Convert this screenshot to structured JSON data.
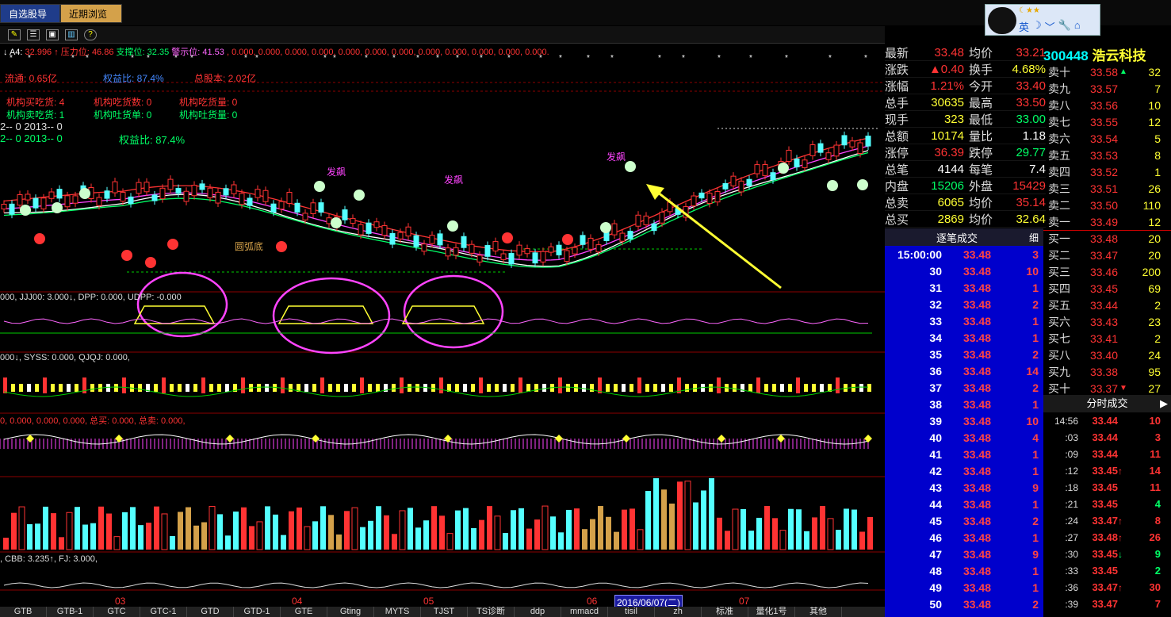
{
  "toolbar": {
    "tabs": [
      "自选股导入",
      "近期浏览"
    ],
    "icons": [
      "wand-icon",
      "list-icon",
      "info-icon",
      "chart-icon",
      "help-icon"
    ]
  },
  "qq": {
    "labels": [
      "英",
      "☽",
      "﹀",
      "🔧",
      "⌂"
    ]
  },
  "indicator_line": {
    "prefix": "↓ A4:",
    "a4": "32.996",
    "pressure_label": "↑ 压力位:",
    "pressure": "46.86",
    "support_label": "支撑位:",
    "support": "32.35",
    "warn_label": "警示位:",
    "warn": "41.53",
    "rest": ", 0.000, 0.000, 0.000, 0.000, 0.000, 0.000, 0.000, 0.000, 0.000, 0.000, 0.000, 0.000."
  },
  "info_lines": {
    "liutong": "流通: 0.65亿",
    "quanyi": "权益比: 87.4%",
    "zongguben": "总股本: 2.02亿",
    "jg1": "机构买吃货: 4",
    "jg2": "机构吃货数: 0",
    "jg3": "机构吃货量: 0",
    "jg4": "机构卖吃货: 1",
    "jg5": "机构吐货单: 0",
    "jg6": "机构吐货量: 0",
    "y1": "2-- 0    2013-- 0",
    "y2": "2-- 0    2013-- 0",
    "quanyi2": "权益比: 87.4%"
  },
  "annotations": {
    "fabiao": "发飙",
    "yuanhudi": "圆弧底"
  },
  "panel1_label": "000, JJJ00: 3.000↓, DPP: 0.000, UDPP: -0.000",
  "panel2_label": "000↓, SYSS: 0.000, QJQJ: 0.000,",
  "panel3_label": "0, 0.000, 0.000, 0.000, 总买: 0.000, 总卖: 0.000,",
  "panel5_label": ", CBB: 3.235↑, FJ: 3.000,",
  "date_axis": {
    "labels": [
      "03",
      "04",
      "05",
      "06",
      "07"
    ],
    "cursor": "2016/06/07(二)"
  },
  "bottom_tabs": [
    "GTB",
    "GTB-1",
    "GTC",
    "GTC-1",
    "GTD",
    "GTD-1",
    "GTE",
    "Gting",
    "MYTS",
    "TJST",
    "TS诊断",
    "ddp",
    "mmacd",
    "tisil",
    "zh",
    "标准",
    "量化1号",
    "其他"
  ],
  "stock": {
    "code": "300448",
    "name": "浩云科技"
  },
  "quote": [
    {
      "l1": "最新",
      "v1": "33.48",
      "c1": "#ff3333",
      "l2": "均价",
      "v2": "33.21",
      "c2": "#ff3333"
    },
    {
      "l1": "涨跌",
      "v1": "▲0.40",
      "c1": "#ff3333",
      "l2": "换手",
      "v2": "4.68%",
      "c2": "#ffff33"
    },
    {
      "l1": "涨幅",
      "v1": "1.21%",
      "c1": "#ff3333",
      "l2": "今开",
      "v2": "33.40",
      "c2": "#ff3333"
    },
    {
      "l1": "总手",
      "v1": "30635",
      "c1": "#ffff33",
      "l2": "最高",
      "v2": "33.50",
      "c2": "#ff3333"
    },
    {
      "l1": "现手",
      "v1": "323",
      "c1": "#ffff33",
      "l2": "最低",
      "v2": "33.00",
      "c2": "#00ff66"
    },
    {
      "l1": "总额",
      "v1": "10174",
      "c1": "#ffff33",
      "l2": "量比",
      "v2": "1.18",
      "c2": "#ffffff"
    },
    {
      "l1": "涨停",
      "v1": "36.39",
      "c1": "#ff3333",
      "l2": "跌停",
      "v2": "29.77",
      "c2": "#00ff66"
    },
    {
      "l1": "总笔",
      "v1": "4144",
      "c1": "#ffffff",
      "l2": "每笔",
      "v2": "7.4",
      "c2": "#ffffff"
    },
    {
      "l1": "内盘",
      "v1": "15206",
      "c1": "#00ff66",
      "l2": "外盘",
      "v2": "15429",
      "c2": "#ff3333"
    },
    {
      "l1": "总卖",
      "v1": "6065",
      "c1": "#ffff33",
      "l2": "均价",
      "v2": "35.14",
      "c2": "#ff3333"
    },
    {
      "l1": "总买",
      "v1": "2869",
      "c1": "#ffff33",
      "l2": "均价",
      "v2": "32.64",
      "c2": "#ffff33"
    }
  ],
  "orderbook": [
    {
      "l": "卖十",
      "p": "33.58",
      "a": "▲",
      "ac": "#00ff66",
      "v": "32"
    },
    {
      "l": "卖九",
      "p": "33.57",
      "a": "",
      "ac": "",
      "v": "7"
    },
    {
      "l": "卖八",
      "p": "33.56",
      "a": "",
      "ac": "",
      "v": "10"
    },
    {
      "l": "卖七",
      "p": "33.55",
      "a": "",
      "ac": "",
      "v": "12"
    },
    {
      "l": "卖六",
      "p": "33.54",
      "a": "",
      "ac": "",
      "v": "5"
    },
    {
      "l": "卖五",
      "p": "33.53",
      "a": "",
      "ac": "",
      "v": "8"
    },
    {
      "l": "卖四",
      "p": "33.52",
      "a": "",
      "ac": "",
      "v": "1"
    },
    {
      "l": "卖三",
      "p": "33.51",
      "a": "",
      "ac": "",
      "v": "26"
    },
    {
      "l": "卖二",
      "p": "33.50",
      "a": "",
      "ac": "",
      "v": "110"
    },
    {
      "l": "卖一",
      "p": "33.49",
      "a": "",
      "ac": "",
      "v": "12"
    },
    {
      "l": "买一",
      "p": "33.48",
      "a": "",
      "ac": "",
      "v": "20"
    },
    {
      "l": "买二",
      "p": "33.47",
      "a": "",
      "ac": "",
      "v": "20"
    },
    {
      "l": "买三",
      "p": "33.46",
      "a": "",
      "ac": "",
      "v": "200"
    },
    {
      "l": "买四",
      "p": "33.45",
      "a": "",
      "ac": "",
      "v": "69"
    },
    {
      "l": "买五",
      "p": "33.44",
      "a": "",
      "ac": "",
      "v": "2"
    },
    {
      "l": "买六",
      "p": "33.43",
      "a": "",
      "ac": "",
      "v": "23"
    },
    {
      "l": "买七",
      "p": "33.41",
      "a": "",
      "ac": "",
      "v": "2"
    },
    {
      "l": "买八",
      "p": "33.40",
      "a": "",
      "ac": "",
      "v": "24"
    },
    {
      "l": "买九",
      "p": "33.38",
      "a": "",
      "ac": "",
      "v": "95"
    },
    {
      "l": "买十",
      "p": "33.37",
      "a": "▼",
      "ac": "#ff3333",
      "v": "27"
    }
  ],
  "trades_header": {
    "title": "逐笔成交",
    "detail": "细"
  },
  "trades": [
    {
      "t": "15:00:00",
      "p": "33.48",
      "v": "3"
    },
    {
      "t": "30",
      "p": "33.48",
      "v": "10"
    },
    {
      "t": "31",
      "p": "33.48",
      "v": "1"
    },
    {
      "t": "32",
      "p": "33.48",
      "v": "2"
    },
    {
      "t": "33",
      "p": "33.48",
      "v": "1"
    },
    {
      "t": "34",
      "p": "33.48",
      "v": "1"
    },
    {
      "t": "35",
      "p": "33.48",
      "v": "2"
    },
    {
      "t": "36",
      "p": "33.48",
      "v": "14"
    },
    {
      "t": "37",
      "p": "33.48",
      "v": "2"
    },
    {
      "t": "38",
      "p": "33.48",
      "v": "1"
    },
    {
      "t": "39",
      "p": "33.48",
      "v": "10"
    },
    {
      "t": "40",
      "p": "33.48",
      "v": "4"
    },
    {
      "t": "41",
      "p": "33.48",
      "v": "1"
    },
    {
      "t": "42",
      "p": "33.48",
      "v": "1"
    },
    {
      "t": "43",
      "p": "33.48",
      "v": "9"
    },
    {
      "t": "44",
      "p": "33.48",
      "v": "1"
    },
    {
      "t": "45",
      "p": "33.48",
      "v": "2"
    },
    {
      "t": "46",
      "p": "33.48",
      "v": "1"
    },
    {
      "t": "47",
      "p": "33.48",
      "v": "9"
    },
    {
      "t": "48",
      "p": "33.48",
      "v": "1"
    },
    {
      "t": "49",
      "p": "33.48",
      "v": "1"
    },
    {
      "t": "50",
      "p": "33.48",
      "v": "2"
    }
  ],
  "ticks_header": {
    "title": "分时成交",
    "arrow": "▶"
  },
  "ticks": [
    {
      "t": "14:56",
      "p": "33.44",
      "a": "",
      "ac": "",
      "v": "10",
      "vc": "#ff3333"
    },
    {
      "t": ":03",
      "p": "33.44",
      "a": "",
      "ac": "",
      "v": "3",
      "vc": "#ff3333"
    },
    {
      "t": ":09",
      "p": "33.44",
      "a": "",
      "ac": "",
      "v": "11",
      "vc": "#ff3333"
    },
    {
      "t": ":12",
      "p": "33.45",
      "a": "↑",
      "ac": "#ff3333",
      "v": "14",
      "vc": "#ff3333"
    },
    {
      "t": ":18",
      "p": "33.45",
      "a": "",
      "ac": "",
      "v": "11",
      "vc": "#ff3333"
    },
    {
      "t": ":21",
      "p": "33.45",
      "a": "",
      "ac": "",
      "v": "4",
      "vc": "#00ff66"
    },
    {
      "t": ":24",
      "p": "33.47",
      "a": "↑",
      "ac": "#ff3333",
      "v": "8",
      "vc": "#ff3333"
    },
    {
      "t": ":27",
      "p": "33.48",
      "a": "↑",
      "ac": "#ff3333",
      "v": "26",
      "vc": "#ff3333"
    },
    {
      "t": ":30",
      "p": "33.45",
      "a": "↓",
      "ac": "#00ff66",
      "v": "9",
      "vc": "#00ff66"
    },
    {
      "t": ":33",
      "p": "33.45",
      "a": "",
      "ac": "",
      "v": "2",
      "vc": "#00ff66"
    },
    {
      "t": ":36",
      "p": "33.47",
      "a": "↑",
      "ac": "#ff3333",
      "v": "30",
      "vc": "#ff3333"
    },
    {
      "t": ":39",
      "p": "33.47",
      "a": "",
      "ac": "",
      "v": "7",
      "vc": "#ff3333"
    }
  ]
}
